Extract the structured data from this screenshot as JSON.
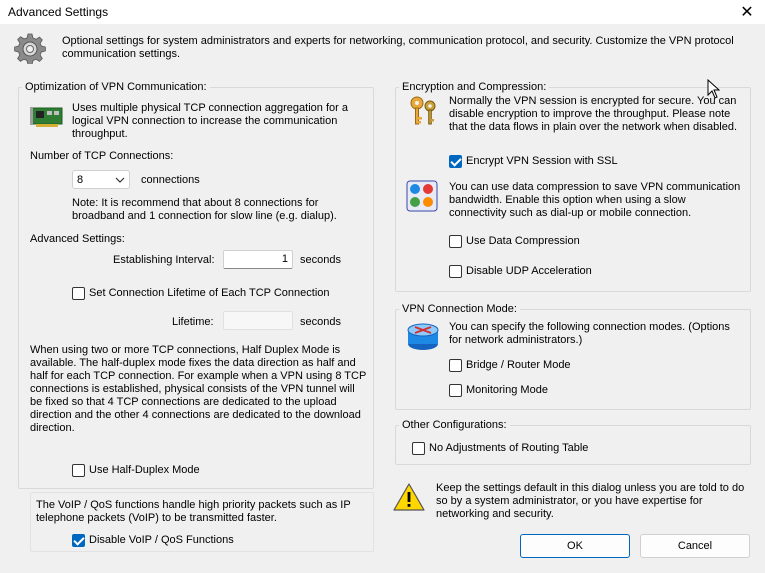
{
  "window": {
    "title": "Advanced Settings",
    "close_glyph": "✕"
  },
  "intro": {
    "icon": "gear-icon",
    "text": "Optional settings for system administrators and experts for networking, communication protocol, and security. Customize the VPN protocol communication settings."
  },
  "optimization": {
    "legend": "Optimization of VPN Communication:",
    "icon": "network-card-icon",
    "description": "Uses multiple physical TCP connection aggregation for a logical VPN connection to increase the communication throughput.",
    "num_connections_label": "Number of TCP Connections:",
    "num_connections_value": "8",
    "connections_unit": "connections",
    "note": "Note: It is recommend that about 8 connections for broadband and 1 connection for slow line (e.g. dialup).",
    "advanced_label": "Advanced Settings:",
    "interval_label": "Establishing Interval:",
    "interval_value": "1",
    "interval_unit": "seconds",
    "lifetime_checkbox_label": "Set Connection Lifetime of Each TCP Connection",
    "lifetime_checked": false,
    "lifetime_label": "Lifetime:",
    "lifetime_value": "",
    "lifetime_unit": "seconds",
    "half_duplex_text": "When using two or more TCP connections, Half Duplex Mode is available. The half-duplex mode fixes the data direction as half and half for each TCP connection. For example when a VPN using 8 TCP connections is established, physical consists of the VPN tunnel will be fixed so that 4 TCP connections are dedicated to the upload direction and the other 4 connections are dedicated to the download direction.",
    "half_duplex_label": "Use Half-Duplex Mode",
    "half_duplex_checked": false
  },
  "voip": {
    "text": "The VoIP / QoS functions handle high priority packets such as IP telephone packets (VoIP) to be transmitted faster.",
    "checkbox_label": "Disable VoIP / QoS Functions",
    "checked": true
  },
  "encryption": {
    "legend": "Encryption and Compression:",
    "keys_icon": "keys-icon",
    "encrypt_text": "Normally the VPN session is encrypted for secure. You can disable encryption to improve the throughput. Please note that the data flows in plain over the network when disabled.",
    "encrypt_label": "Encrypt VPN Session with SSL",
    "encrypt_checked": true,
    "compress_icon": "compression-icon",
    "compress_text": "You can use data compression to save VPN communication bandwidth. Enable this option when using a slow connectivity such as dial-up or mobile connection.",
    "compress_label": "Use Data Compression",
    "compress_checked": false,
    "udp_label": "Disable UDP Acceleration",
    "udp_checked": false
  },
  "connection_mode": {
    "legend": "VPN Connection Mode:",
    "icon": "router-icon",
    "text": "You can specify the following connection modes. (Options for network administrators.)",
    "bridge_label": "Bridge / Router Mode",
    "bridge_checked": false,
    "monitoring_label": "Monitoring Mode",
    "monitoring_checked": false
  },
  "other": {
    "legend": "Other Configurations:",
    "routing_label": "No Adjustments of Routing Table",
    "routing_checked": false
  },
  "warning": {
    "icon": "warning-icon",
    "text": "Keep the settings default in this dialog unless you are told to do so by a system administrator, or you have expertise for networking and security."
  },
  "buttons": {
    "ok": "OK",
    "cancel": "Cancel"
  }
}
